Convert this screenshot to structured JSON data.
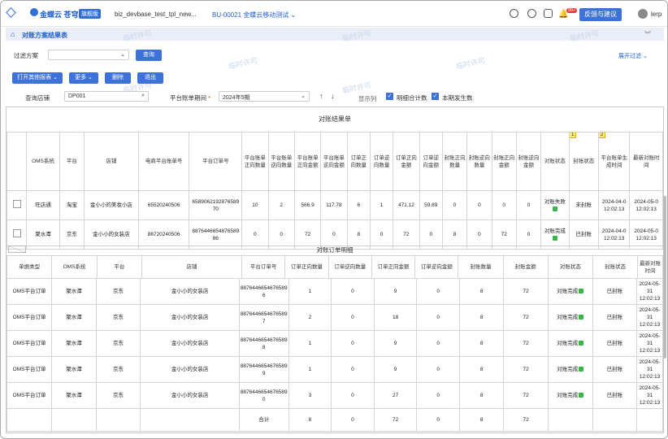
{
  "topbar": {
    "logo": "金蝶云 苍穹",
    "version": "旗舰版",
    "tab_app": "biz_devbase_test_tpl_new...",
    "tab_org": "BU-00021 金蝶云移动测试",
    "notif_count": "99+",
    "feedback": "反馈与建议",
    "user": "lerp"
  },
  "title": {
    "page": "对账方案结果表"
  },
  "watermark": "临时许可",
  "filter": {
    "label": "过滤方案",
    "query_btn": "查询",
    "expand": "展开过滤"
  },
  "toolbar": {
    "open_report": "打开其他报表",
    "more": "更多",
    "delete": "删除",
    "exit": "退出"
  },
  "search": {
    "store_label": "查询店铺",
    "store_value": "DP001",
    "period_label": "平台账单期间",
    "period_value": "2024年5期",
    "display_label": "显示列",
    "opt1": "明细合计数",
    "opt2": "本期发生数"
  },
  "sheet": {
    "title": "对账结果单",
    "marks": [
      "1",
      "2"
    ],
    "headers": [
      "OMS系统",
      "平台",
      "店铺",
      "电商平台账单号",
      "平台订单号",
      "平台账单正向数量",
      "平台账单逆向数量",
      "平台账单正向金额",
      "平台账单逆向金额",
      "订单正向数量",
      "订单逆向数量",
      "订单正向金额",
      "订单逆向金额",
      "封账正向数量",
      "封账逆向数量",
      "封账正向金额",
      "封账逆向金额",
      "对账状态",
      "封账状态",
      "平台账单生成时间",
      "最新对账时间"
    ],
    "rows": [
      [
        "旺店通",
        "淘宝",
        "金小小的美妆小店",
        "65520240506",
        "6589062192876589 70",
        "10",
        "2",
        "566.9",
        "117.78",
        "6",
        "1",
        "471.12",
        "59.89",
        "0",
        "0",
        "0",
        "0",
        "对账失败",
        "未封账",
        "2024-04-0 12:02:13",
        "2024-05-0 12:02:13"
      ],
      [
        "聚水潭",
        "京东",
        "金小小的女装店",
        "88720240506",
        "8876446654876589 86",
        "0",
        "0",
        "72",
        "0",
        "8",
        "0",
        "72",
        "0",
        "8",
        "0",
        "72",
        "0",
        "对账完成",
        "已封账",
        "2024-04-0 12:02:13",
        "2024-05-0 12:02:13"
      ]
    ],
    "detail_title": "对账订单明细",
    "detail_headers": [
      "单据类型",
      "OMS系统",
      "平台",
      "店铺",
      "平台订单号",
      "订单正向数量",
      "订单逆向数量",
      "订单正向金额",
      "订单逆向金额",
      "封账数量",
      "封账金额",
      "对账状态",
      "封账状态",
      "最新对账时间"
    ],
    "detail_rows": [
      [
        "OMS平台订单",
        "聚水潭",
        "京东",
        "金小小的女装店",
        "8876446654676589 6",
        "1",
        "0",
        "9",
        "0",
        "8",
        "72",
        "对账完成",
        "已封账",
        "2024-05-31 12:02:13"
      ],
      [
        "OMS平台订单",
        "聚水潭",
        "京东",
        "金小小的女装店",
        "8876446654676589 7",
        "2",
        "0",
        "18",
        "0",
        "8",
        "72",
        "对账完成",
        "已封账",
        "2024-05-31 12:02:13"
      ],
      [
        "OMS平台订单",
        "聚水潭",
        "京东",
        "金小小的女装店",
        "8876446654676589 8",
        "1",
        "0",
        "9",
        "0",
        "8",
        "72",
        "对账完成",
        "已封账",
        "2024-05-31 12:02:13"
      ],
      [
        "OMS平台订单",
        "聚水潭",
        "京东",
        "金小小的女装店",
        "8876446654676589 9",
        "1",
        "0",
        "9",
        "0",
        "8",
        "72",
        "对账完成",
        "已封账",
        "2024-05-31 12:02:13"
      ],
      [
        "OMS平台订单",
        "聚水潭",
        "京东",
        "金小小的女装店",
        "8876446654676589 0",
        "3",
        "0",
        "27",
        "0",
        "8",
        "72",
        "对账完成",
        "已封账",
        "2024-05-31 12:02:13"
      ]
    ],
    "total": [
      "合计",
      "8",
      "0",
      "72",
      "0",
      "8",
      "72"
    ]
  }
}
